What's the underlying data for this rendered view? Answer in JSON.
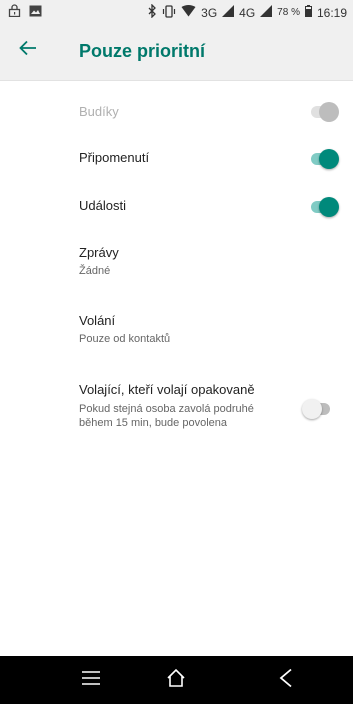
{
  "status_bar": {
    "signal_3g": "3G",
    "signal_4g": "4G",
    "battery": "78 %",
    "time": "16:19"
  },
  "header": {
    "title": "Pouze prioritní",
    "back_icon": "arrow-left-icon"
  },
  "settings": [
    {
      "title": "Budíky",
      "state": "disabled-on"
    },
    {
      "title": "Připomenutí",
      "state": "on"
    },
    {
      "title": "Události",
      "state": "on"
    },
    {
      "title": "Zprávy",
      "subtitle": "Žádné"
    },
    {
      "title": "Volání",
      "subtitle": "Pouze od kontaktů"
    },
    {
      "title": "Volající, kteří volají opakovaně",
      "subtitle": "Pokud stejná osoba zavolá podruhé během 15 min, bude povolena",
      "state": "off"
    }
  ],
  "colors": {
    "accent": "#00796b",
    "switch_on": "#00897b",
    "switch_track_on": "#80cbc4"
  },
  "nav_bar": {
    "menu_icon": "menu-icon",
    "home_icon": "home-icon",
    "back_icon": "back-triangle-icon"
  }
}
